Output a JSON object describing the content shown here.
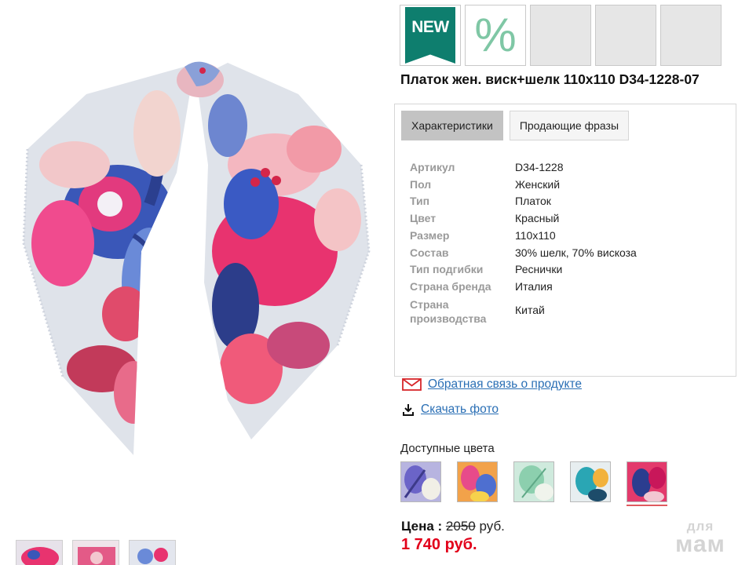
{
  "badges": {
    "new_label": "NEW",
    "discount_symbol": "%"
  },
  "product": {
    "title": "Платок жен. виск+шелк 110x110 D34-1228-07"
  },
  "tabs": [
    {
      "label": "Характеристики",
      "active": true
    },
    {
      "label": "Продающие фразы",
      "active": false
    }
  ],
  "specs": [
    {
      "key": "Артикул",
      "value": "D34-1228"
    },
    {
      "key": "Пол",
      "value": "Женский"
    },
    {
      "key": "Тип",
      "value": "Платок"
    },
    {
      "key": "Цвет",
      "value": "Красный"
    },
    {
      "key": "Размер",
      "value": "110x110"
    },
    {
      "key": "Состав",
      "value": "30% шелк, 70% вискоза"
    },
    {
      "key": "Тип подгибки",
      "value": "Реснички"
    },
    {
      "key": "Страна бренда",
      "value": "Италия"
    },
    {
      "key": "Страна производства",
      "value": "Китай"
    }
  ],
  "links": {
    "feedback": "Обратная связь о продукте",
    "download": "Скачать фото"
  },
  "colors": {
    "label": "Доступные цвета",
    "swatches": [
      "blue-violet",
      "orange-pink",
      "mint-green",
      "turquoise",
      "red-navy"
    ],
    "selected_index": 4
  },
  "price": {
    "label": "Цена :",
    "old": "2050",
    "old_unit": "руб.",
    "sale": "1 740 руб."
  },
  "watermark": {
    "line1": "для",
    "line2": "мам"
  },
  "theme": {
    "badge_green": "#0e7e6e",
    "link_blue": "#2a6fb5",
    "sale_red": "#e2001a"
  }
}
